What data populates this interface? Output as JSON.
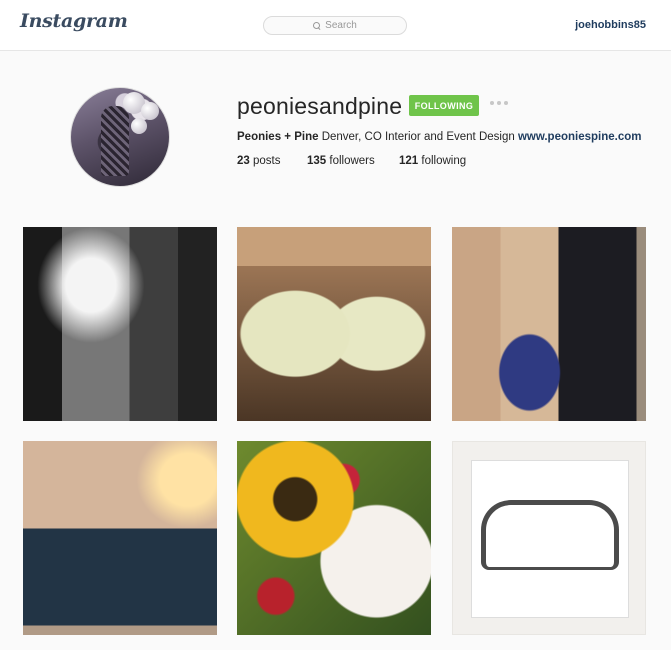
{
  "header": {
    "logo": "Instagram",
    "search_placeholder": "Search",
    "current_user": "joehobbins85"
  },
  "profile": {
    "username": "peoniesandpine",
    "follow_status": "FOLLOWING",
    "bio_name": "Peonies + Pine",
    "bio_text": " Denver, CO Interior and Event Design ",
    "bio_link": "www.peoniespine.com",
    "stats": {
      "posts_count": "23",
      "posts_label": " posts",
      "followers_count": "135",
      "followers_label": " followers",
      "following_count": "121",
      "following_label": " following"
    }
  },
  "icons": {
    "search": "search-icon",
    "more": "more-options-icon"
  },
  "colors": {
    "following_button": "#6fc44a",
    "link": "#1f3c5e",
    "background": "#fafafa"
  }
}
